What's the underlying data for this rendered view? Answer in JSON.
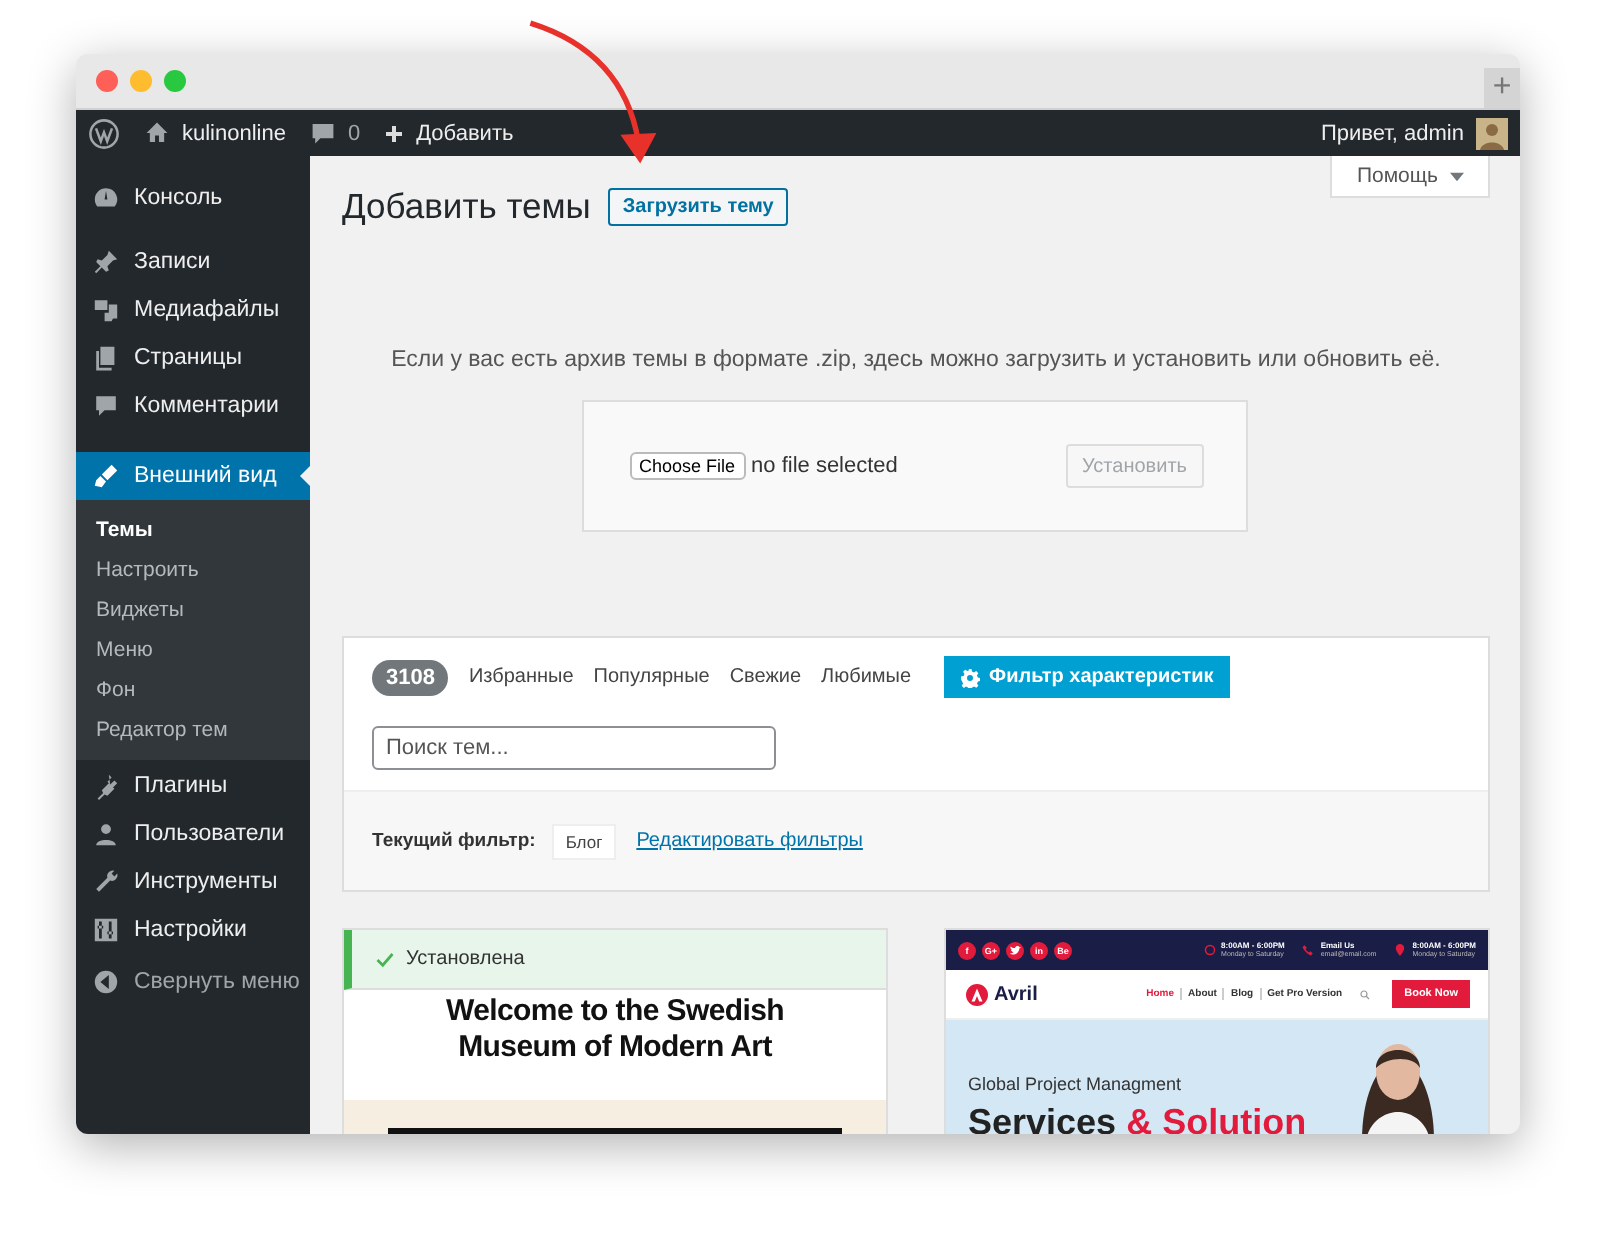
{
  "browser": {
    "new_tab": "+"
  },
  "admin_bar": {
    "site_name": "kulinonline",
    "comments_count": "0",
    "new_label": "Добавить",
    "greeting": "Привет, admin"
  },
  "sidebar": {
    "items": [
      {
        "label": "Консоль",
        "selected": false
      },
      {
        "label": "Записи",
        "selected": false
      },
      {
        "label": "Медиафайлы",
        "selected": false
      },
      {
        "label": "Страницы",
        "selected": false
      },
      {
        "label": "Комментарии",
        "selected": false
      },
      {
        "label": "Внешний вид",
        "selected": true,
        "children": [
          {
            "label": "Темы",
            "selected": true
          },
          {
            "label": "Настроить",
            "selected": false
          },
          {
            "label": "Виджеты",
            "selected": false
          },
          {
            "label": "Меню",
            "selected": false
          },
          {
            "label": "Фон",
            "selected": false
          },
          {
            "label": "Редактор тем",
            "selected": false
          }
        ]
      },
      {
        "label": "Плагины",
        "selected": false
      },
      {
        "label": "Пользователи",
        "selected": false
      },
      {
        "label": "Инструменты",
        "selected": false
      },
      {
        "label": "Настройки",
        "selected": false
      }
    ],
    "collapse": "Свернуть меню"
  },
  "header": {
    "title": "Добавить темы",
    "upload_button": "Загрузить тему",
    "help": "Помощь"
  },
  "upload": {
    "hint": "Если у вас есть архив темы в формате .zip, здесь можно загрузить и установить или обновить её.",
    "choose_file": "Choose File",
    "file_status": "no file selected",
    "install_button": {
      "label": "Установить",
      "disabled": true
    }
  },
  "filter": {
    "count": "3108",
    "tabs": [
      {
        "label": "Избранные",
        "selected": false
      },
      {
        "label": "Популярные",
        "selected": false
      },
      {
        "label": "Свежие",
        "selected": false
      },
      {
        "label": "Любимые",
        "selected": false
      }
    ],
    "feature_filter": "Фильтр характеристик",
    "search": {
      "placeholder": "Поиск тем..."
    },
    "current_filter_label": "Текущий фильтр:",
    "current_tags": [
      "Блог"
    ],
    "edit_link": "Редактировать фильтры"
  },
  "themes": [
    {
      "kind": "museum",
      "installed": true,
      "notice": "Установлена",
      "heading": "Welcome to the Swedish Museum of Modern Art"
    },
    {
      "kind": "avril",
      "installed": false,
      "socials": [
        "f",
        "G+",
        "in",
        "Be"
      ],
      "contacts": [
        {
          "title": "8:00AM - 6:00PM",
          "detail": "Monday to Saturday"
        },
        {
          "title": "Email Us",
          "detail": "email@email.com"
        },
        {
          "title": "8:00AM - 6:00PM",
          "detail": "Monday to Saturday"
        }
      ],
      "logo": "Avril",
      "nav": [
        {
          "label": "Home",
          "selected": true
        },
        {
          "label": "About",
          "selected": false
        },
        {
          "label": "Blog",
          "selected": false
        },
        {
          "label": "Get Pro Version",
          "selected": false
        }
      ],
      "cta": "Book Now",
      "kicker": "Global Project Managment",
      "title": "Services",
      "title_accent": "& Solution"
    }
  ]
}
